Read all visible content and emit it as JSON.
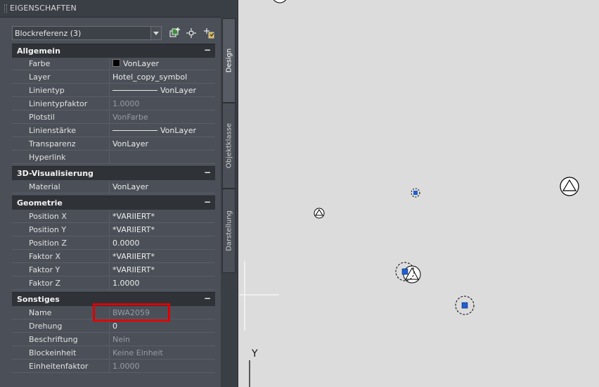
{
  "palette": {
    "title": "EIGENSCHAFTEN"
  },
  "selector": {
    "value": "Blockreferenz (3)"
  },
  "toolbar": {
    "icons": [
      "toggle-pickadd-icon",
      "select-objects-icon",
      "quick-select-icon"
    ]
  },
  "categories": {
    "allgemein": {
      "label": "Allgemein",
      "toggle": "−",
      "rows": [
        {
          "name": "Farbe",
          "value": "VonLayer"
        },
        {
          "name": "Layer",
          "value": "Hotel_copy_symbol"
        },
        {
          "name": "Linientyp",
          "value": "VonLayer"
        },
        {
          "name": "Linientypfaktor",
          "value": "1.0000"
        },
        {
          "name": "Plotstil",
          "value": "VonFarbe"
        },
        {
          "name": "Linienstärke",
          "value": "VonLayer"
        },
        {
          "name": "Transparenz",
          "value": "VonLayer"
        },
        {
          "name": "Hyperlink",
          "value": ""
        }
      ]
    },
    "visualisierung": {
      "label": "3D-Visualisierung",
      "toggle": "−",
      "rows": [
        {
          "name": "Material",
          "value": "VonLayer"
        }
      ]
    },
    "geometrie": {
      "label": "Geometrie",
      "toggle": "−",
      "rows": [
        {
          "name": "Position X",
          "value": "*VARIIERT*"
        },
        {
          "name": "Position Y",
          "value": "*VARIIERT*"
        },
        {
          "name": "Position Z",
          "value": "0.0000"
        },
        {
          "name": "Faktor X",
          "value": "*VARIIERT*"
        },
        {
          "name": "Faktor Y",
          "value": "*VARIIERT*"
        },
        {
          "name": "Faktor Z",
          "value": "1.0000"
        }
      ]
    },
    "sonstiges": {
      "label": "Sonstiges",
      "toggle": "−",
      "rows": [
        {
          "name": "Name",
          "value": "BWA2059"
        },
        {
          "name": "Drehung",
          "value": "0"
        },
        {
          "name": "Beschriftung",
          "value": "Nein"
        },
        {
          "name": "Blockeinheit",
          "value": "Keine Einheit"
        },
        {
          "name": "Einheitenfaktor",
          "value": "1.0000"
        }
      ]
    }
  },
  "side_tabs": [
    "Design",
    "Objektklasse",
    "Darstellung"
  ],
  "canvas": {
    "axis_label": "Y"
  },
  "colors": {
    "highlight": "#e00000",
    "grip": "#1f5fd0",
    "canvas_bg": "#dcdcdc"
  }
}
